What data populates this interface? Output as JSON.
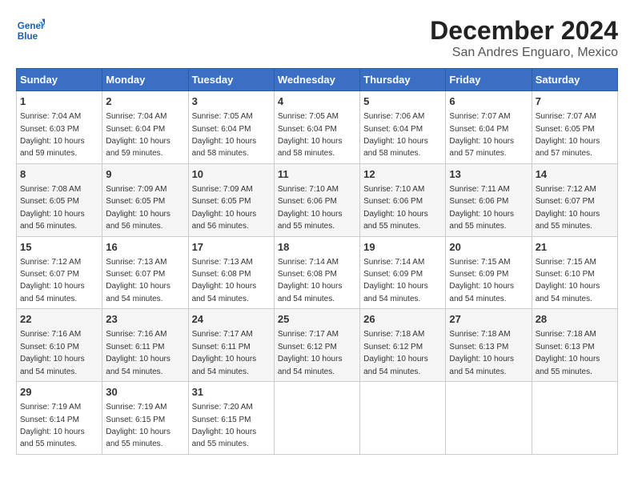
{
  "header": {
    "logo_general": "General",
    "logo_blue": "Blue",
    "title": "December 2024",
    "subtitle": "San Andres Enguaro, Mexico"
  },
  "calendar": {
    "days_of_week": [
      "Sunday",
      "Monday",
      "Tuesday",
      "Wednesday",
      "Thursday",
      "Friday",
      "Saturday"
    ],
    "weeks": [
      [
        null,
        null,
        null,
        null,
        null,
        null,
        null
      ]
    ],
    "cells": [
      {
        "day": 1,
        "sunrise": "7:04 AM",
        "sunset": "6:03 PM",
        "daylight": "10 hours and 59 minutes."
      },
      {
        "day": 2,
        "sunrise": "7:04 AM",
        "sunset": "6:04 PM",
        "daylight": "10 hours and 59 minutes."
      },
      {
        "day": 3,
        "sunrise": "7:05 AM",
        "sunset": "6:04 PM",
        "daylight": "10 hours and 58 minutes."
      },
      {
        "day": 4,
        "sunrise": "7:05 AM",
        "sunset": "6:04 PM",
        "daylight": "10 hours and 58 minutes."
      },
      {
        "day": 5,
        "sunrise": "7:06 AM",
        "sunset": "6:04 PM",
        "daylight": "10 hours and 58 minutes."
      },
      {
        "day": 6,
        "sunrise": "7:07 AM",
        "sunset": "6:04 PM",
        "daylight": "10 hours and 57 minutes."
      },
      {
        "day": 7,
        "sunrise": "7:07 AM",
        "sunset": "6:05 PM",
        "daylight": "10 hours and 57 minutes."
      },
      {
        "day": 8,
        "sunrise": "7:08 AM",
        "sunset": "6:05 PM",
        "daylight": "10 hours and 56 minutes."
      },
      {
        "day": 9,
        "sunrise": "7:09 AM",
        "sunset": "6:05 PM",
        "daylight": "10 hours and 56 minutes."
      },
      {
        "day": 10,
        "sunrise": "7:09 AM",
        "sunset": "6:05 PM",
        "daylight": "10 hours and 56 minutes."
      },
      {
        "day": 11,
        "sunrise": "7:10 AM",
        "sunset": "6:06 PM",
        "daylight": "10 hours and 55 minutes."
      },
      {
        "day": 12,
        "sunrise": "7:10 AM",
        "sunset": "6:06 PM",
        "daylight": "10 hours and 55 minutes."
      },
      {
        "day": 13,
        "sunrise": "7:11 AM",
        "sunset": "6:06 PM",
        "daylight": "10 hours and 55 minutes."
      },
      {
        "day": 14,
        "sunrise": "7:12 AM",
        "sunset": "6:07 PM",
        "daylight": "10 hours and 55 minutes."
      },
      {
        "day": 15,
        "sunrise": "7:12 AM",
        "sunset": "6:07 PM",
        "daylight": "10 hours and 54 minutes."
      },
      {
        "day": 16,
        "sunrise": "7:13 AM",
        "sunset": "6:07 PM",
        "daylight": "10 hours and 54 minutes."
      },
      {
        "day": 17,
        "sunrise": "7:13 AM",
        "sunset": "6:08 PM",
        "daylight": "10 hours and 54 minutes."
      },
      {
        "day": 18,
        "sunrise": "7:14 AM",
        "sunset": "6:08 PM",
        "daylight": "10 hours and 54 minutes."
      },
      {
        "day": 19,
        "sunrise": "7:14 AM",
        "sunset": "6:09 PM",
        "daylight": "10 hours and 54 minutes."
      },
      {
        "day": 20,
        "sunrise": "7:15 AM",
        "sunset": "6:09 PM",
        "daylight": "10 hours and 54 minutes."
      },
      {
        "day": 21,
        "sunrise": "7:15 AM",
        "sunset": "6:10 PM",
        "daylight": "10 hours and 54 minutes."
      },
      {
        "day": 22,
        "sunrise": "7:16 AM",
        "sunset": "6:10 PM",
        "daylight": "10 hours and 54 minutes."
      },
      {
        "day": 23,
        "sunrise": "7:16 AM",
        "sunset": "6:11 PM",
        "daylight": "10 hours and 54 minutes."
      },
      {
        "day": 24,
        "sunrise": "7:17 AM",
        "sunset": "6:11 PM",
        "daylight": "10 hours and 54 minutes."
      },
      {
        "day": 25,
        "sunrise": "7:17 AM",
        "sunset": "6:12 PM",
        "daylight": "10 hours and 54 minutes."
      },
      {
        "day": 26,
        "sunrise": "7:18 AM",
        "sunset": "6:12 PM",
        "daylight": "10 hours and 54 minutes."
      },
      {
        "day": 27,
        "sunrise": "7:18 AM",
        "sunset": "6:13 PM",
        "daylight": "10 hours and 54 minutes."
      },
      {
        "day": 28,
        "sunrise": "7:18 AM",
        "sunset": "6:13 PM",
        "daylight": "10 hours and 55 minutes."
      },
      {
        "day": 29,
        "sunrise": "7:19 AM",
        "sunset": "6:14 PM",
        "daylight": "10 hours and 55 minutes."
      },
      {
        "day": 30,
        "sunrise": "7:19 AM",
        "sunset": "6:15 PM",
        "daylight": "10 hours and 55 minutes."
      },
      {
        "day": 31,
        "sunrise": "7:20 AM",
        "sunset": "6:15 PM",
        "daylight": "10 hours and 55 minutes."
      }
    ]
  }
}
